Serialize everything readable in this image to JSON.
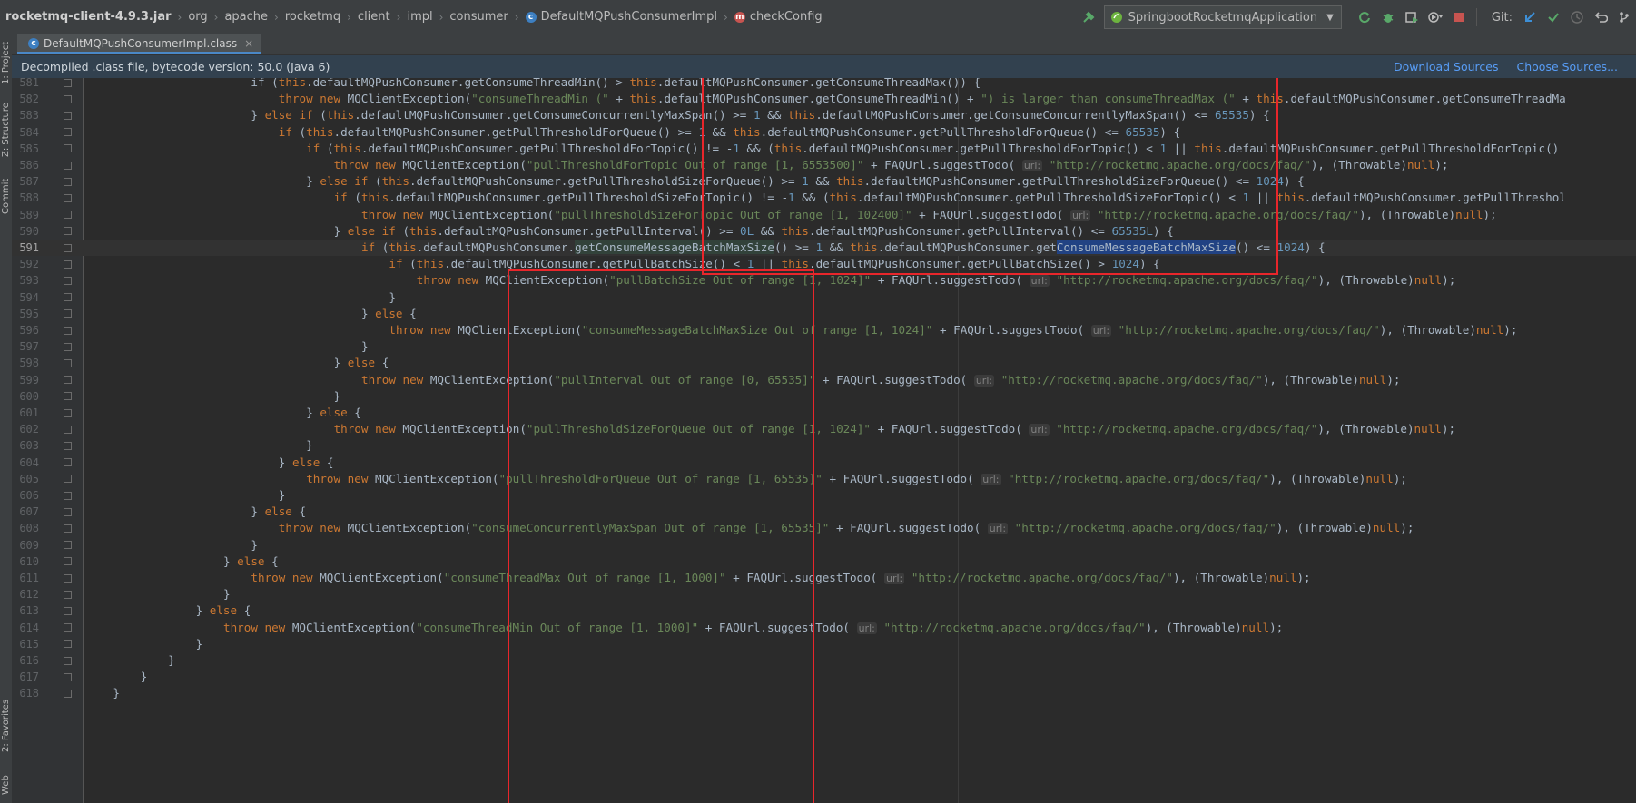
{
  "breadcrumbs": [
    "rocketmq-client-4.9.3.jar",
    "org",
    "apache",
    "rocketmq",
    "client",
    "impl",
    "consumer",
    "DefaultMQPushConsumerImpl",
    "checkConfig"
  ],
  "run_config": "SpringbootRocketmqApplication",
  "git_label": "Git:",
  "tab": {
    "label": "DefaultMQPushConsumerImpl.class",
    "close": "×"
  },
  "banner": {
    "text": "Decompiled .class file, bytecode version: 50.0 (Java 6)",
    "download": "Download Sources",
    "choose": "Choose Sources..."
  },
  "side_tools": [
    "1: Project",
    "Z: Structure",
    "Commit",
    "2: Favorites",
    "Web"
  ],
  "colors": {
    "keyword": "#cc7832",
    "string": "#6a8759",
    "number": "#6897bb",
    "annotation_box": "#e8262b",
    "selection": "#214283"
  },
  "hint_label": "url:",
  "current_line": 591,
  "lines": [
    {
      "n": 581,
      "i": 6,
      "s": [
        [
          "t",
          "if ("
        ],
        [
          "k",
          "this"
        ],
        [
          "t",
          ".defaultMQPushConsumer.getConsumeThreadMin() > "
        ],
        [
          "k",
          "this"
        ],
        [
          "t",
          ".defaultMQPushConsumer.getConsumeThreadMax()) {"
        ]
      ]
    },
    {
      "n": 582,
      "i": 7,
      "s": [
        [
          "k",
          "throw new "
        ],
        [
          "t",
          "MQClientException("
        ],
        [
          "s",
          "\"consumeThreadMin (\""
        ],
        [
          "t",
          " + "
        ],
        [
          "k",
          "this"
        ],
        [
          "t",
          ".defaultMQPushConsumer.getConsumeThreadMin() + "
        ],
        [
          "s",
          "\") is larger than consumeThreadMax (\""
        ],
        [
          "t",
          " + "
        ],
        [
          "k",
          "this"
        ],
        [
          "t",
          ".defaultMQPushConsumer.getConsumeThreadMa"
        ]
      ]
    },
    {
      "n": 583,
      "i": 6,
      "s": [
        [
          "t",
          "} "
        ],
        [
          "k",
          "else if "
        ],
        [
          "t",
          "("
        ],
        [
          "k",
          "this"
        ],
        [
          "t",
          ".defaultMQPushConsumer.getConsumeConcurrentlyMaxSpan() >= "
        ],
        [
          "n",
          "1"
        ],
        [
          "t",
          " && "
        ],
        [
          "k",
          "this"
        ],
        [
          "t",
          ".defaultMQPushConsumer.getConsumeConcurrentlyMaxSpan() <= "
        ],
        [
          "n",
          "65535"
        ],
        [
          "t",
          ") {"
        ]
      ]
    },
    {
      "n": 584,
      "i": 7,
      "s": [
        [
          "k",
          "if "
        ],
        [
          "t",
          "("
        ],
        [
          "k",
          "this"
        ],
        [
          "t",
          ".defaultMQPushConsumer.getPullThresholdForQueue() >= "
        ],
        [
          "n",
          "1"
        ],
        [
          "t",
          " && "
        ],
        [
          "k",
          "this"
        ],
        [
          "t",
          ".defaultMQPushConsumer.getPullThresholdForQueue() <= "
        ],
        [
          "n",
          "65535"
        ],
        [
          "t",
          ") {"
        ]
      ]
    },
    {
      "n": 585,
      "i": 8,
      "s": [
        [
          "k",
          "if "
        ],
        [
          "t",
          "("
        ],
        [
          "k",
          "this"
        ],
        [
          "t",
          ".defaultMQPushConsumer.getPullThresholdForTopic() != -"
        ],
        [
          "n",
          "1"
        ],
        [
          "t",
          " && ("
        ],
        [
          "k",
          "this"
        ],
        [
          "t",
          ".defaultMQPushConsumer.getPullThresholdForTopic() < "
        ],
        [
          "n",
          "1"
        ],
        [
          "t",
          " || "
        ],
        [
          "k",
          "this"
        ],
        [
          "t",
          ".defaultMQPushConsumer.getPullThresholdForTopic() "
        ]
      ]
    },
    {
      "n": 586,
      "i": 9,
      "s": [
        [
          "k",
          "throw new "
        ],
        [
          "t",
          "MQClientException("
        ],
        [
          "s",
          "\"pullThresholdForTopic Out of range [1, 6553500]\""
        ],
        [
          "t",
          " + FAQUrl.suggestTodo( "
        ],
        [
          "h",
          "url:"
        ],
        [
          "t",
          " "
        ],
        [
          "s",
          "\"http://rocketmq.apache.org/docs/faq/\""
        ],
        [
          "t",
          "), (Throwable)"
        ],
        [
          "k",
          "null"
        ],
        [
          "t",
          ");"
        ]
      ]
    },
    {
      "n": 587,
      "i": 8,
      "s": [
        [
          "t",
          "} "
        ],
        [
          "k",
          "else if "
        ],
        [
          "t",
          "("
        ],
        [
          "k",
          "this"
        ],
        [
          "t",
          ".defaultMQPushConsumer.getPullThresholdSizeForQueue() >= "
        ],
        [
          "n",
          "1"
        ],
        [
          "t",
          " && "
        ],
        [
          "k",
          "this"
        ],
        [
          "t",
          ".defaultMQPushConsumer.getPullThresholdSizeForQueue() <= "
        ],
        [
          "n",
          "1024"
        ],
        [
          "t",
          ") {"
        ]
      ]
    },
    {
      "n": 588,
      "i": 9,
      "s": [
        [
          "k",
          "if "
        ],
        [
          "t",
          "("
        ],
        [
          "k",
          "this"
        ],
        [
          "t",
          ".defaultMQPushConsumer.getPullThresholdSizeForTopic() != -"
        ],
        [
          "n",
          "1"
        ],
        [
          "t",
          " && ("
        ],
        [
          "k",
          "this"
        ],
        [
          "t",
          ".defaultMQPushConsumer.getPullThresholdSizeForTopic() < "
        ],
        [
          "n",
          "1"
        ],
        [
          "t",
          " || "
        ],
        [
          "k",
          "this"
        ],
        [
          "t",
          ".defaultMQPushConsumer.getPullThreshol"
        ]
      ]
    },
    {
      "n": 589,
      "i": 10,
      "s": [
        [
          "k",
          "throw new "
        ],
        [
          "t",
          "MQClientException("
        ],
        [
          "s",
          "\"pullThresholdSizeForTopic Out of range [1, 102400]\""
        ],
        [
          "t",
          " + FAQUrl.suggestTodo( "
        ],
        [
          "h",
          "url:"
        ],
        [
          "t",
          " "
        ],
        [
          "s",
          "\"http://rocketmq.apache.org/docs/faq/\""
        ],
        [
          "t",
          "), (Throwable)"
        ],
        [
          "k",
          "null"
        ],
        [
          "t",
          ");"
        ]
      ]
    },
    {
      "n": 590,
      "i": 9,
      "s": [
        [
          "t",
          "} "
        ],
        [
          "k",
          "else if "
        ],
        [
          "t",
          "("
        ],
        [
          "k",
          "this"
        ],
        [
          "t",
          ".defaultMQPushConsumer.getPullInterval() >= "
        ],
        [
          "n",
          "0L"
        ],
        [
          "t",
          " && "
        ],
        [
          "k",
          "this"
        ],
        [
          "t",
          ".defaultMQPushConsumer.getPullInterval() <= "
        ],
        [
          "n",
          "65535L"
        ],
        [
          "t",
          ") {"
        ]
      ]
    },
    {
      "n": 591,
      "i": 10,
      "s": [
        [
          "k",
          "if "
        ],
        [
          "t",
          "("
        ],
        [
          "k",
          "this"
        ],
        [
          "t",
          ".defaultMQPushConsumer."
        ],
        [
          "w",
          "getConsumeMessageBatchMaxSize"
        ],
        [
          "t",
          "() >= "
        ],
        [
          "n",
          "1"
        ],
        [
          "t",
          " && "
        ],
        [
          "k",
          "this"
        ],
        [
          "t",
          ".defaultMQPushConsumer.get"
        ],
        [
          "x",
          "ConsumeMessageBatchMaxSize"
        ],
        [
          "t",
          "() <= "
        ],
        [
          "n",
          "1024"
        ],
        [
          "t",
          ") {"
        ]
      ]
    },
    {
      "n": 592,
      "i": 11,
      "s": [
        [
          "k",
          "if "
        ],
        [
          "t",
          "("
        ],
        [
          "k",
          "this"
        ],
        [
          "t",
          ".defaultMQPushConsumer.getPullBatchSize() < "
        ],
        [
          "n",
          "1"
        ],
        [
          "t",
          " || "
        ],
        [
          "k",
          "this"
        ],
        [
          "t",
          ".defaultMQPushConsumer.getPullBatchSize() > "
        ],
        [
          "n",
          "1024"
        ],
        [
          "t",
          ") {"
        ]
      ]
    },
    {
      "n": 593,
      "i": 12,
      "s": [
        [
          "k",
          "throw new "
        ],
        [
          "t",
          "MQClientException("
        ],
        [
          "s",
          "\"pullBatchSize Out of range [1, 1024]\""
        ],
        [
          "t",
          " + FAQUrl.suggestTodo( "
        ],
        [
          "h",
          "url:"
        ],
        [
          "t",
          " "
        ],
        [
          "s",
          "\"http://rocketmq.apache.org/docs/faq/\""
        ],
        [
          "t",
          "), (Throwable)"
        ],
        [
          "k",
          "null"
        ],
        [
          "t",
          ");"
        ]
      ]
    },
    {
      "n": 594,
      "i": 11,
      "s": [
        [
          "t",
          "}"
        ]
      ]
    },
    {
      "n": 595,
      "i": 10,
      "s": [
        [
          "t",
          "} "
        ],
        [
          "k",
          "else "
        ],
        [
          "t",
          "{"
        ]
      ]
    },
    {
      "n": 596,
      "i": 11,
      "s": [
        [
          "k",
          "throw new "
        ],
        [
          "t",
          "MQClientException("
        ],
        [
          "s",
          "\"consumeMessageBatchMaxSize Out of range [1, 1024]\""
        ],
        [
          "t",
          " + FAQUrl.suggestTodo( "
        ],
        [
          "h",
          "url:"
        ],
        [
          "t",
          " "
        ],
        [
          "s",
          "\"http://rocketmq.apache.org/docs/faq/\""
        ],
        [
          "t",
          "), (Throwable)"
        ],
        [
          "k",
          "null"
        ],
        [
          "t",
          ");"
        ]
      ]
    },
    {
      "n": 597,
      "i": 10,
      "s": [
        [
          "t",
          "}"
        ]
      ]
    },
    {
      "n": 598,
      "i": 9,
      "s": [
        [
          "t",
          "} "
        ],
        [
          "k",
          "else "
        ],
        [
          "t",
          "{"
        ]
      ]
    },
    {
      "n": 599,
      "i": 10,
      "s": [
        [
          "k",
          "throw new "
        ],
        [
          "t",
          "MQClientException("
        ],
        [
          "s",
          "\"pullInterval Out of range [0, 65535]\""
        ],
        [
          "t",
          " + FAQUrl.suggestTodo( "
        ],
        [
          "h",
          "url:"
        ],
        [
          "t",
          " "
        ],
        [
          "s",
          "\"http://rocketmq.apache.org/docs/faq/\""
        ],
        [
          "t",
          "), (Throwable)"
        ],
        [
          "k",
          "null"
        ],
        [
          "t",
          ");"
        ]
      ]
    },
    {
      "n": 600,
      "i": 9,
      "s": [
        [
          "t",
          "}"
        ]
      ]
    },
    {
      "n": 601,
      "i": 8,
      "s": [
        [
          "t",
          "} "
        ],
        [
          "k",
          "else "
        ],
        [
          "t",
          "{"
        ]
      ]
    },
    {
      "n": 602,
      "i": 9,
      "s": [
        [
          "k",
          "throw new "
        ],
        [
          "t",
          "MQClientException("
        ],
        [
          "s",
          "\"pullThresholdSizeForQueue Out of range [1, 1024]\""
        ],
        [
          "t",
          " + FAQUrl.suggestTodo( "
        ],
        [
          "h",
          "url:"
        ],
        [
          "t",
          " "
        ],
        [
          "s",
          "\"http://rocketmq.apache.org/docs/faq/\""
        ],
        [
          "t",
          "), (Throwable)"
        ],
        [
          "k",
          "null"
        ],
        [
          "t",
          ");"
        ]
      ]
    },
    {
      "n": 603,
      "i": 8,
      "s": [
        [
          "t",
          "}"
        ]
      ]
    },
    {
      "n": 604,
      "i": 7,
      "s": [
        [
          "t",
          "} "
        ],
        [
          "k",
          "else "
        ],
        [
          "t",
          "{"
        ]
      ]
    },
    {
      "n": 605,
      "i": 8,
      "s": [
        [
          "k",
          "throw new "
        ],
        [
          "t",
          "MQClientException("
        ],
        [
          "s",
          "\"pullThresholdForQueue Out of range [1, 65535]\""
        ],
        [
          "t",
          " + FAQUrl.suggestTodo( "
        ],
        [
          "h",
          "url:"
        ],
        [
          "t",
          " "
        ],
        [
          "s",
          "\"http://rocketmq.apache.org/docs/faq/\""
        ],
        [
          "t",
          "), (Throwable)"
        ],
        [
          "k",
          "null"
        ],
        [
          "t",
          ");"
        ]
      ]
    },
    {
      "n": 606,
      "i": 7,
      "s": [
        [
          "t",
          "}"
        ]
      ]
    },
    {
      "n": 607,
      "i": 6,
      "s": [
        [
          "t",
          "} "
        ],
        [
          "k",
          "else "
        ],
        [
          "t",
          "{"
        ]
      ]
    },
    {
      "n": 608,
      "i": 7,
      "s": [
        [
          "k",
          "throw new "
        ],
        [
          "t",
          "MQClientException("
        ],
        [
          "s",
          "\"consumeConcurrentlyMaxSpan Out of range [1, 65535]\""
        ],
        [
          "t",
          " + FAQUrl.suggestTodo( "
        ],
        [
          "h",
          "url:"
        ],
        [
          "t",
          " "
        ],
        [
          "s",
          "\"http://rocketmq.apache.org/docs/faq/\""
        ],
        [
          "t",
          "), (Throwable)"
        ],
        [
          "k",
          "null"
        ],
        [
          "t",
          ");"
        ]
      ]
    },
    {
      "n": 609,
      "i": 6,
      "s": [
        [
          "t",
          "}"
        ]
      ]
    },
    {
      "n": 610,
      "i": 5,
      "s": [
        [
          "t",
          "} "
        ],
        [
          "k",
          "else "
        ],
        [
          "t",
          "{"
        ]
      ]
    },
    {
      "n": 611,
      "i": 6,
      "s": [
        [
          "k",
          "throw new "
        ],
        [
          "t",
          "MQClientException("
        ],
        [
          "s",
          "\"consumeThreadMax Out of range [1, 1000]\""
        ],
        [
          "t",
          " + FAQUrl.suggestTodo( "
        ],
        [
          "h",
          "url:"
        ],
        [
          "t",
          " "
        ],
        [
          "s",
          "\"http://rocketmq.apache.org/docs/faq/\""
        ],
        [
          "t",
          "), (Throwable)"
        ],
        [
          "k",
          "null"
        ],
        [
          "t",
          ");"
        ]
      ]
    },
    {
      "n": 612,
      "i": 5,
      "s": [
        [
          "t",
          "}"
        ]
      ]
    },
    {
      "n": 613,
      "i": 4,
      "s": [
        [
          "t",
          "} "
        ],
        [
          "k",
          "else "
        ],
        [
          "t",
          "{"
        ]
      ]
    },
    {
      "n": 614,
      "i": 5,
      "s": [
        [
          "k",
          "throw new "
        ],
        [
          "t",
          "MQClientException("
        ],
        [
          "s",
          "\"consumeThreadMin Out of range [1, 1000]\""
        ],
        [
          "t",
          " + FAQUrl.suggestTodo( "
        ],
        [
          "h",
          "url:"
        ],
        [
          "t",
          " "
        ],
        [
          "s",
          "\"http://rocketmq.apache.org/docs/faq/\""
        ],
        [
          "t",
          "), (Throwable)"
        ],
        [
          "k",
          "null"
        ],
        [
          "t",
          ");"
        ]
      ]
    },
    {
      "n": 615,
      "i": 4,
      "s": [
        [
          "t",
          "}"
        ]
      ]
    },
    {
      "n": 616,
      "i": 3,
      "s": [
        [
          "t",
          "}"
        ]
      ]
    },
    {
      "n": 617,
      "i": 2,
      "s": [
        [
          "t",
          "}"
        ]
      ]
    },
    {
      "n": 618,
      "i": 1,
      "s": [
        [
          "t",
          "}"
        ]
      ]
    }
  ]
}
